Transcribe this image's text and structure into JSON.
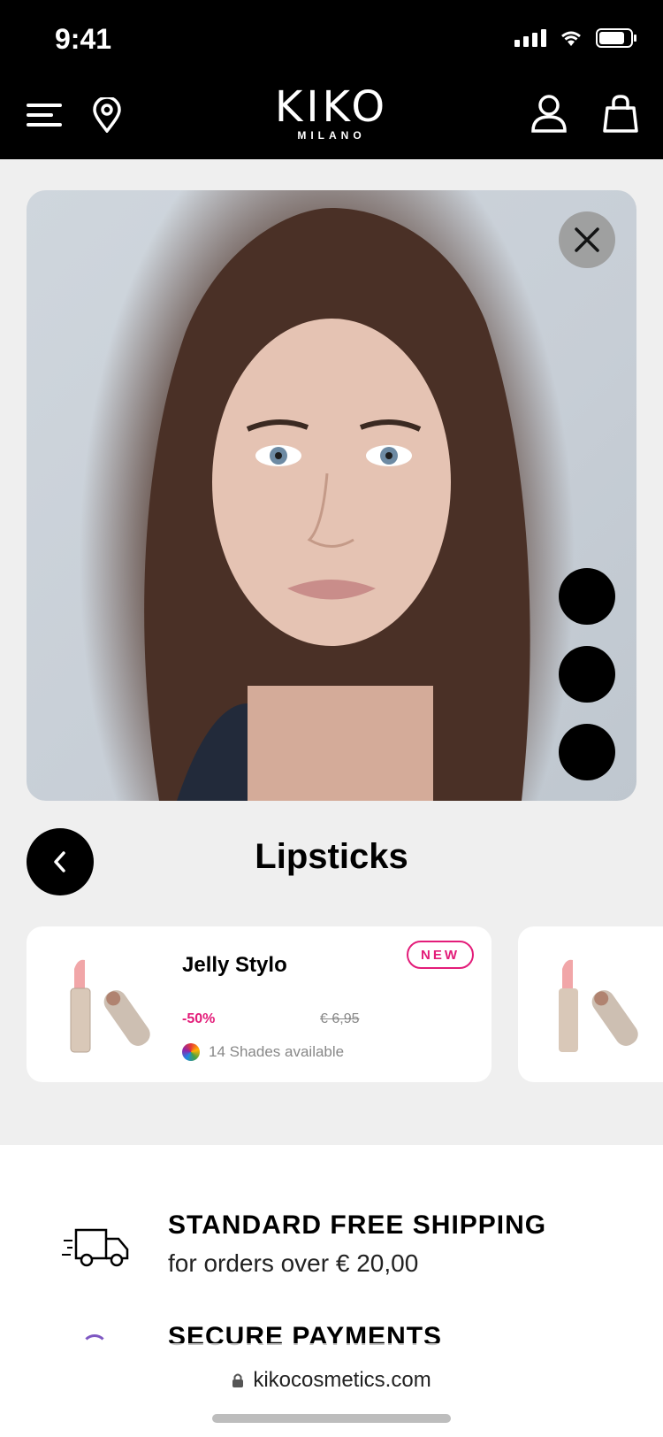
{
  "status_bar": {
    "time": "9:41"
  },
  "brand": {
    "name": "KIKO",
    "sub": "MILANO"
  },
  "section": {
    "title": "Lipsticks"
  },
  "products": [
    {
      "name": "Jelly Stylo",
      "badge": "NEW",
      "discount": "-50%",
      "old_price": "€ 6,95",
      "shades": "14 Shades available"
    }
  ],
  "footer": {
    "shipping_title": "STANDARD FREE SHIPPING",
    "shipping_sub": "for orders over € 20,00",
    "payments_title": "SECURE PAYMENTS"
  },
  "browser": {
    "url": "kikocosmetics.com"
  },
  "colors": {
    "accent": "#e31c79",
    "header": "#000000",
    "background": "#efefef"
  },
  "icons": [
    "menu-icon",
    "location-pin-icon",
    "user-icon",
    "shopping-bag-icon",
    "close-icon",
    "chevron-left-icon",
    "truck-icon",
    "lock-icon"
  ]
}
